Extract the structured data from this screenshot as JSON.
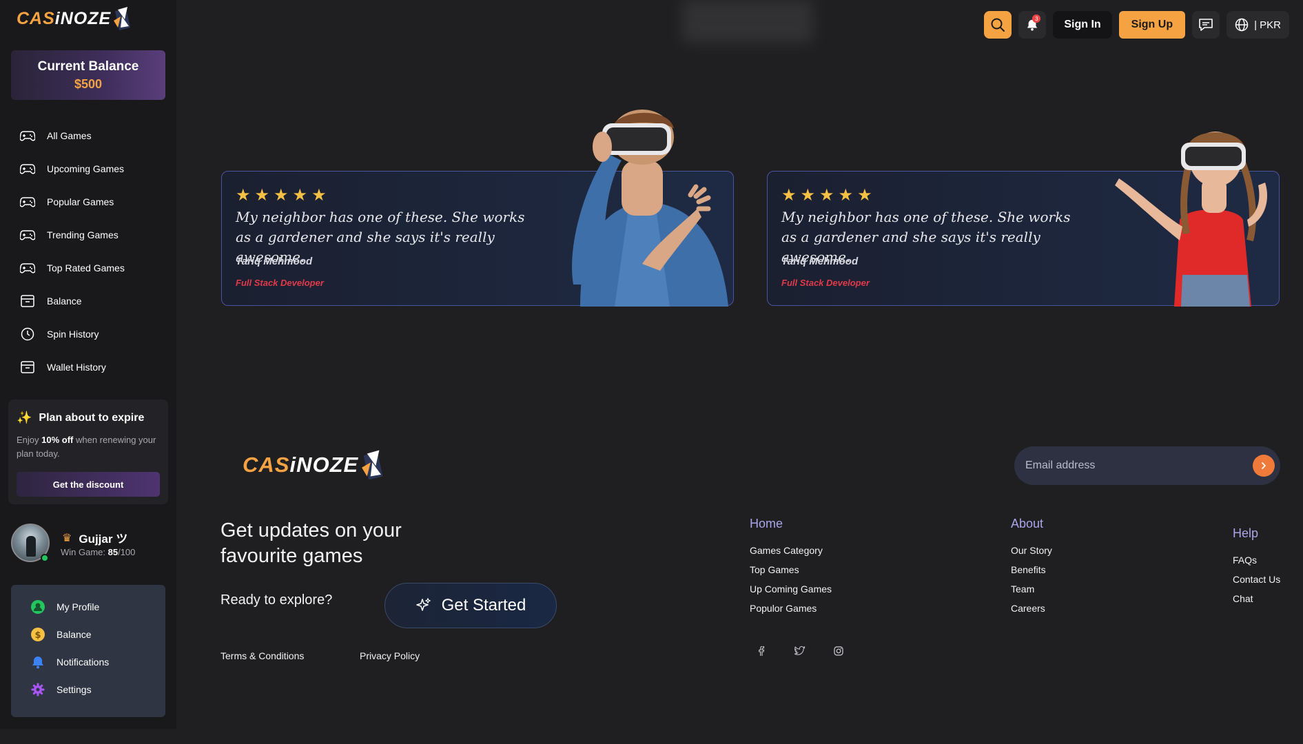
{
  "brand": {
    "part1": "CAS",
    "part2": "iNOZE"
  },
  "sidebar": {
    "balance_title": "Current Balance",
    "balance_value": "$500",
    "items": [
      {
        "label": "All Games",
        "icon": "gamepad-icon"
      },
      {
        "label": "Upcoming Games",
        "icon": "gamepad-icon"
      },
      {
        "label": "Popular Games",
        "icon": "gamepad-icon"
      },
      {
        "label": "Trending Games",
        "icon": "gamepad-icon"
      },
      {
        "label": "Top Rated Games",
        "icon": "gamepad-icon"
      },
      {
        "label": "Balance",
        "icon": "archive-icon"
      },
      {
        "label": "Spin History",
        "icon": "clock-icon"
      },
      {
        "label": "Wallet History",
        "icon": "archive-icon"
      }
    ],
    "plan": {
      "title": "Plan about to expire",
      "desc_pre": "Enjoy ",
      "desc_bold": "10% off",
      "desc_post": " when renewing your plan today.",
      "button": "Get the discount"
    },
    "user": {
      "name": "Gujjar ツ",
      "wins_label": "Win Game: ",
      "wins_value": "85",
      "wins_total": "/100"
    },
    "profile_menu": [
      {
        "label": "My Profile",
        "icon": "user-icon",
        "color": "#22c55e"
      },
      {
        "label": "Balance",
        "icon": "dollar-icon",
        "color": "#f5c043"
      },
      {
        "label": "Notifications",
        "icon": "bell-icon",
        "color": "#3b82f6"
      },
      {
        "label": "Settings",
        "icon": "gear-icon",
        "color": "#a855f7"
      }
    ]
  },
  "header": {
    "notification_count": "3",
    "sign_in": "Sign In",
    "sign_up": "Sign Up",
    "currency": "| PKR"
  },
  "testimonials": [
    {
      "rating": 5,
      "quote": "My neighbor has one of these. She works as a gardener and she says it's really awesome.",
      "author": "Tariq Mehmood",
      "role": "Full Stack Developer"
    },
    {
      "rating": 5,
      "quote": "My neighbor has one of these. She works as a gardener and she says it's really awesome.",
      "author": "Tariq Mehmood",
      "role": "Full Stack Developer"
    }
  ],
  "footer": {
    "email_placeholder": "Email address",
    "headline": "Get updates on your favourite games",
    "ready": "Ready to explore?",
    "get_started": "Get Started",
    "terms": "Terms & Conditions",
    "privacy": "Privacy Policy",
    "columns": [
      {
        "title": "Home",
        "links": [
          "Games Category",
          "Top Games",
          "Up Coming Games",
          "Populor Games"
        ]
      },
      {
        "title": "About",
        "links": [
          "Our Story",
          "Benefits",
          "Team",
          "Careers"
        ]
      },
      {
        "title": "Help",
        "links": [
          "FAQs",
          "Contact Us",
          "Chat"
        ]
      }
    ],
    "socials": [
      "facebook-icon",
      "twitter-icon",
      "instagram-icon"
    ]
  },
  "colors": {
    "accent": "#f5a243",
    "bg": "#1f1f21",
    "sidebar": "#19191b",
    "role": "#e23a4a",
    "link_heading": "#a9a6e8"
  }
}
